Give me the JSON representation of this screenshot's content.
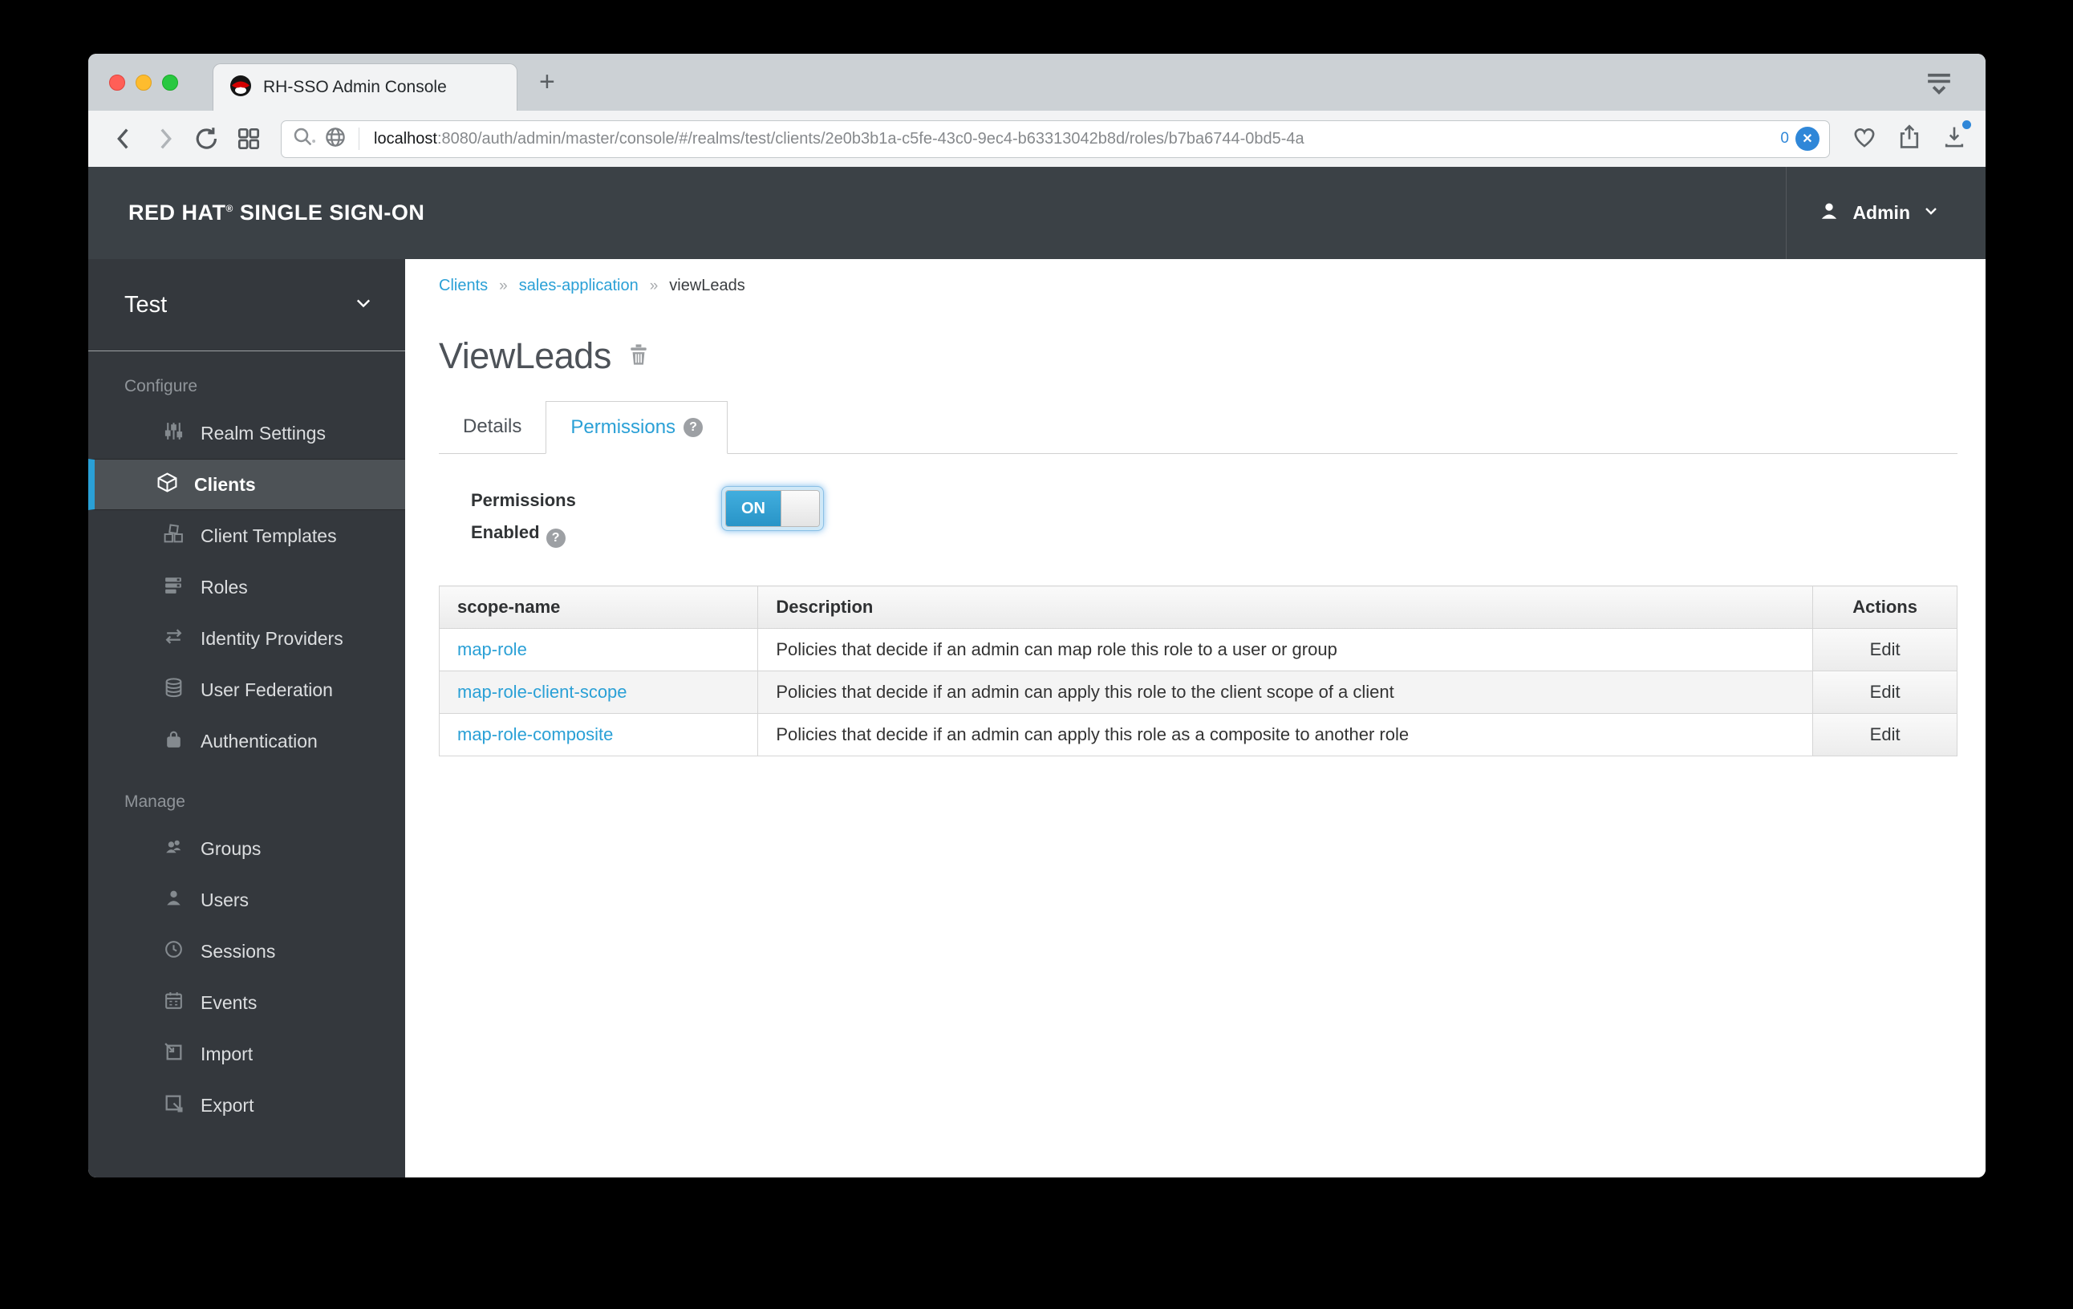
{
  "ui": {
    "help_glyph": "?"
  },
  "browser": {
    "tab_title": "RH-SSO Admin Console",
    "new_tab_glyph": "+",
    "url_host": "localhost",
    "url_rest": ":8080/auth/admin/master/console/#/realms/test/clients/2e0b3b1a-c5fe-43c0-9ec4-b63313042b8d/roles/b7ba6744-0bd5-4a",
    "badge_count": "0",
    "badge_x_glyph": "✕"
  },
  "navbar": {
    "brand_primary": "RED HAT",
    "brand_reg": "®",
    "brand_secondary": " SINGLE SIGN-ON",
    "user": "Admin"
  },
  "sidebar": {
    "realm": "Test",
    "sections": [
      {
        "header": "Configure",
        "items": [
          {
            "label": "Realm Settings",
            "icon": "sliders-icon",
            "active": false
          },
          {
            "label": "Clients",
            "icon": "cube-icon",
            "active": true
          },
          {
            "label": "Client Templates",
            "icon": "cubes-icon",
            "active": false
          },
          {
            "label": "Roles",
            "icon": "list-icon",
            "active": false
          },
          {
            "label": "Identity Providers",
            "icon": "exchange-arrows-icon",
            "active": false
          },
          {
            "label": "User Federation",
            "icon": "database-icon",
            "active": false
          },
          {
            "label": "Authentication",
            "icon": "lock-icon",
            "active": false
          }
        ]
      },
      {
        "header": "Manage",
        "items": [
          {
            "label": "Groups",
            "icon": "users-group-icon",
            "active": false
          },
          {
            "label": "Users",
            "icon": "user-icon",
            "active": false
          },
          {
            "label": "Sessions",
            "icon": "clock-icon",
            "active": false
          },
          {
            "label": "Events",
            "icon": "calendar-icon",
            "active": false
          },
          {
            "label": "Import",
            "icon": "import-icon",
            "active": false
          },
          {
            "label": "Export",
            "icon": "export-icon",
            "active": false
          }
        ]
      }
    ]
  },
  "main": {
    "breadcrumb": {
      "separator": "»",
      "items": [
        "Clients",
        "sales-application",
        "viewLeads"
      ]
    },
    "title": "ViewLeads",
    "tabs": [
      {
        "label": "Details",
        "active": false
      },
      {
        "label": "Permissions",
        "active": true
      }
    ],
    "form": {
      "label_line1": "Permissions",
      "label_line2": "Enabled",
      "toggle_on": "ON"
    },
    "table": {
      "headers": [
        "scope-name",
        "Description",
        "Actions"
      ],
      "rows": [
        {
          "name": "map-role",
          "description": "Policies that decide if an admin can map role this role to a user or group",
          "action": "Edit"
        },
        {
          "name": "map-role-client-scope",
          "description": "Policies that decide if an admin can apply this role to the client scope of a client",
          "action": "Edit"
        },
        {
          "name": "map-role-composite",
          "description": "Policies that decide if an admin can apply this role as a composite to another role",
          "action": "Edit"
        }
      ]
    }
  },
  "colors": {
    "accent_blue": "#2aa0d6",
    "navbar_bg": "#3b4146",
    "sidebar_bg": "#34383d",
    "toggle_on": "#2e9fd4",
    "badge_blue": "#2f87d8"
  }
}
